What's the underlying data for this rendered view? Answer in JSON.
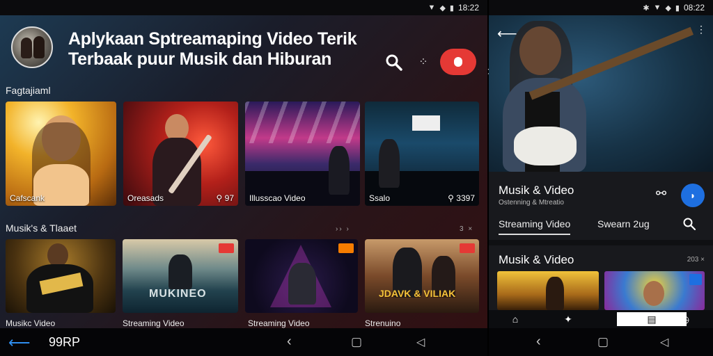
{
  "status_left": {
    "time": "18:22"
  },
  "status_right": {
    "time": "08:22"
  },
  "header": {
    "title_line1": "Aplykaan Sptreamaping Video Terik",
    "title_line2": "Terbaak puur Musik dan Hiburan"
  },
  "section1": {
    "label": "Fagtajiaml",
    "cards": [
      {
        "caption": "Cafscank",
        "badge": ""
      },
      {
        "caption": "Oreasads",
        "badge": "97"
      },
      {
        "caption": "Illusscao Video",
        "badge": ""
      },
      {
        "caption": "Ssalo",
        "badge": "3397"
      }
    ]
  },
  "section2": {
    "label": "Musik's & Tlaaet",
    "more": "›› ›",
    "count": "3 ×",
    "cards": [
      {
        "caption": "Musikc Video",
        "poster_text": ""
      },
      {
        "caption": "Streaming Video",
        "poster_text": "MUKINEO"
      },
      {
        "caption": "Streaming Video",
        "poster_text": ""
      },
      {
        "caption": "Strenuino",
        "poster_text": "JDAVK & VILIAK"
      }
    ]
  },
  "nav_left": {
    "brand": "99RP"
  },
  "detail": {
    "title": "Musik & Video",
    "subtitle": "Ostenning & Mtreatio",
    "tabs": [
      "Streaming Video",
      "Swearn 2ug"
    ],
    "section_title": "Musik & Video",
    "section_count": "203 ×"
  },
  "colors": {
    "accent_red": "#e53935",
    "accent_blue": "#1e6fe0",
    "nav_blue": "#2f8ff0"
  },
  "icons": [
    "search-icon",
    "more-icon",
    "record-icon",
    "back-arrow-icon",
    "home-icon",
    "link-icon",
    "location-icon"
  ]
}
